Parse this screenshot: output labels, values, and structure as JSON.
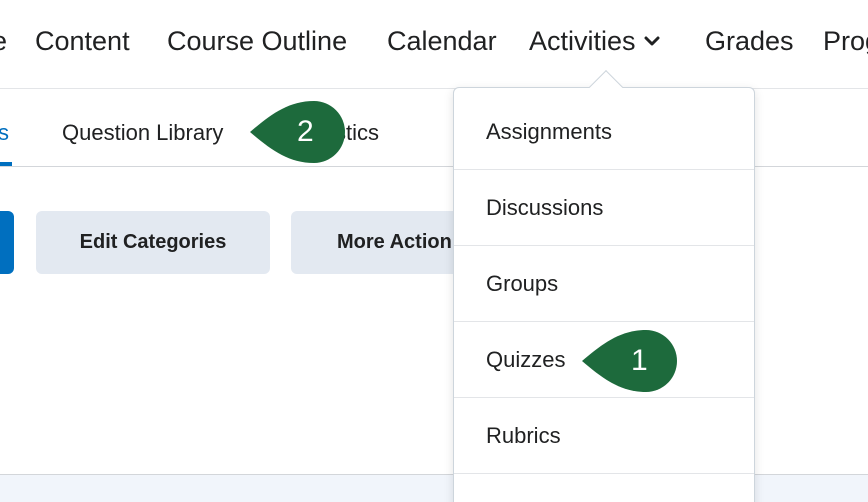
{
  "topnav": {
    "items": [
      {
        "label": "e"
      },
      {
        "label": "Content"
      },
      {
        "label": "Course Outline"
      },
      {
        "label": "Calendar"
      },
      {
        "label": "Activities"
      },
      {
        "label": "Grades"
      },
      {
        "label": "Prog"
      }
    ],
    "activities_expanded": true
  },
  "subnav": {
    "tabs": [
      {
        "label": "s",
        "active": true
      },
      {
        "label": "Question Library"
      },
      {
        "label": "stics"
      }
    ]
  },
  "toolbar": {
    "edit_categories_label": "Edit Categories",
    "more_actions_label": "More Action"
  },
  "dropdown": {
    "items": [
      {
        "label": "Assignments"
      },
      {
        "label": "Discussions"
      },
      {
        "label": "Groups"
      },
      {
        "label": "Quizzes"
      },
      {
        "label": "Rubrics"
      }
    ]
  },
  "callouts": [
    {
      "number": "1",
      "target": "Quizzes"
    },
    {
      "number": "2",
      "target": "Question Library"
    }
  ],
  "colors": {
    "accent": "#006fbf",
    "callout": "#1d6a3c",
    "button_bg": "#e3e9f1"
  },
  "icons": {
    "activities_chevron": "chevron-down-icon"
  }
}
